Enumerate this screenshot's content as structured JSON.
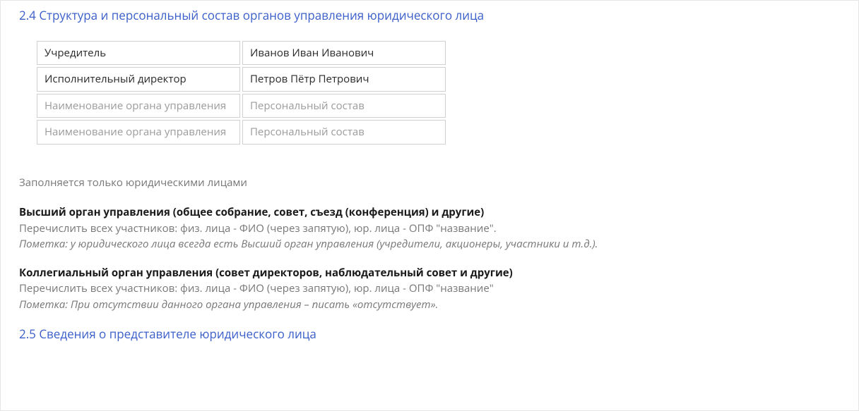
{
  "section24": {
    "heading": "2.4 Структура и персональный состав органов управления юридического лица",
    "rows": [
      {
        "col1": "Учредитель",
        "col2": "Иванов Иван Иванович",
        "filled": true
      },
      {
        "col1": "Исполнительный директор",
        "col2": "Петров Пётр Петрович",
        "filled": true
      },
      {
        "col1": "Наименование органа управления",
        "col2": "Персональный состав",
        "filled": false
      },
      {
        "col1": "Наименование органа управления",
        "col2": "Персональный состав",
        "filled": false
      }
    ],
    "note": "Заполняется только юридическими лицами",
    "block1": {
      "bold": "Высший орган управления (общее собрание, совет, съезд (конференция) и другие)",
      "gray": "Перечислить всех участников: физ. лица - ФИО (через запятую), юр. лица - ОПФ \"название\".",
      "italic": "Пометка: у юридического лица всегда есть Высший орган управления (учредители, акционеры, участники и т.д.)."
    },
    "block2": {
      "bold": "Коллегиальный орган управления (совет директоров, наблюдательный совет и другие)",
      "gray": "Перечислить всех участников: физ. лица - ФИО (через запятую), юр. лица - ОПФ \"название\"",
      "italic": "Пометка: При отсутствии данного органа управления – писать «отсутствует»."
    }
  },
  "section25": {
    "heading": "2.5 Сведения о представителе юридического лица"
  }
}
